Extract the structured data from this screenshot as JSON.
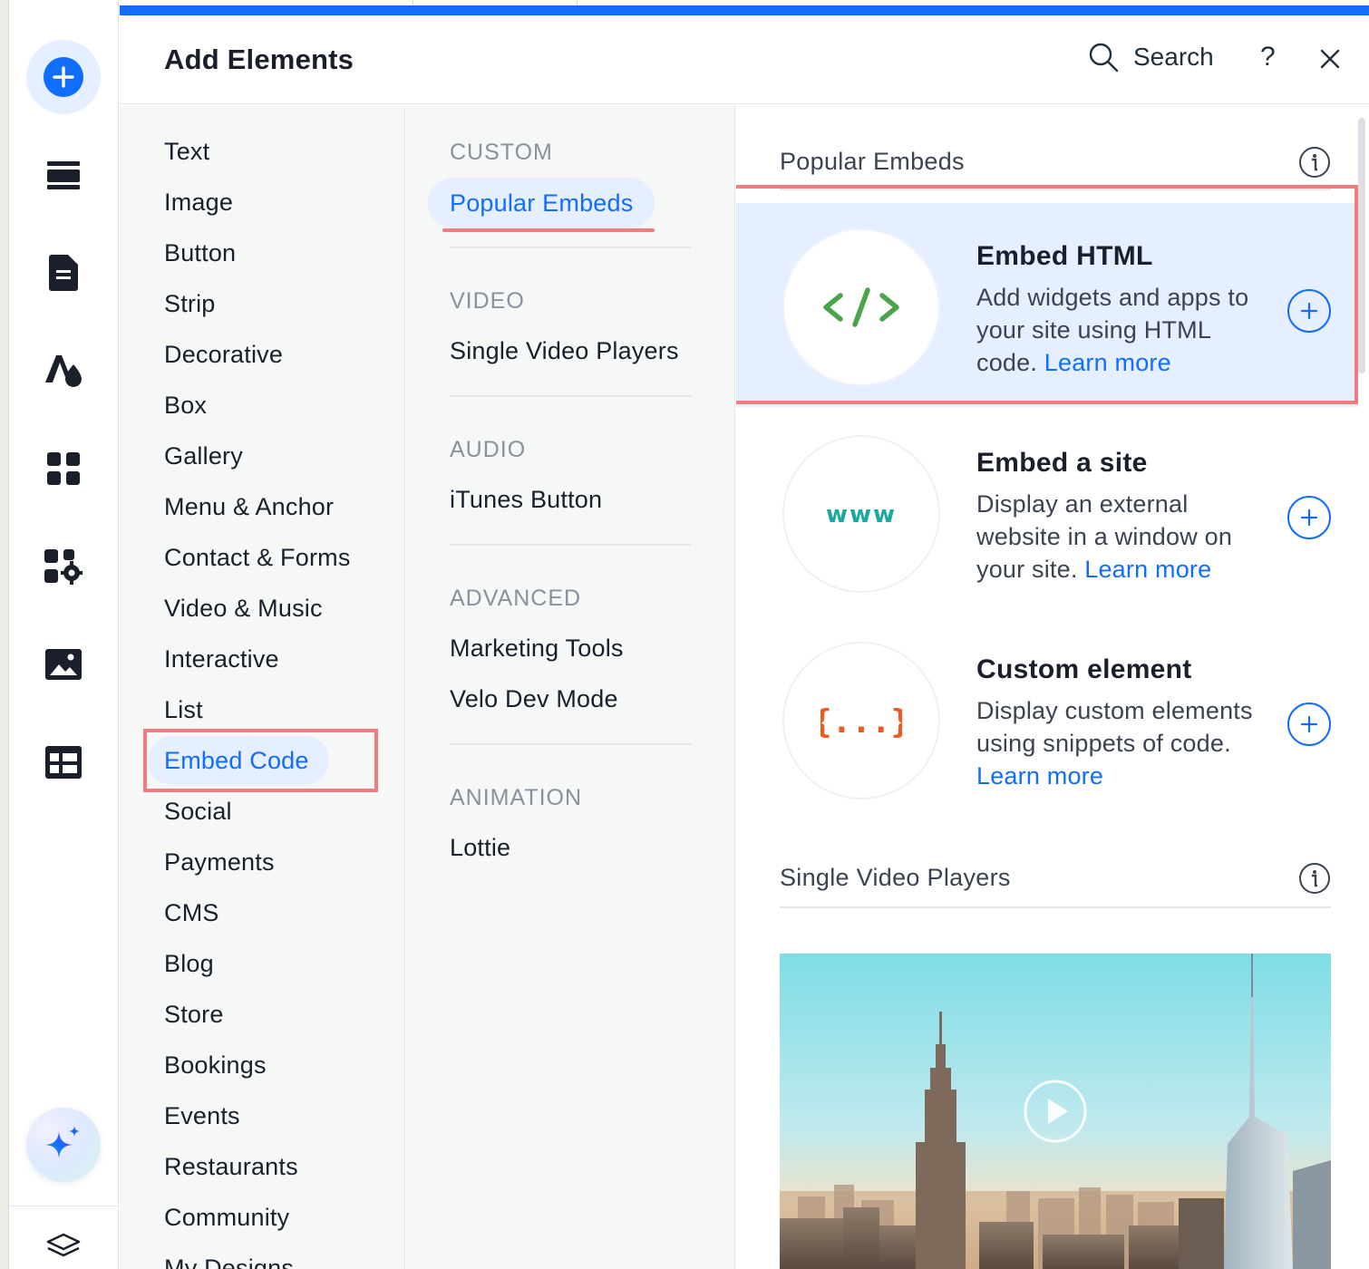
{
  "header": {
    "title": "Add Elements",
    "search_label": "Search",
    "help_label": "?"
  },
  "rail": {
    "icons": [
      "add-icon",
      "sections-icon",
      "pages-icon",
      "theme-icon",
      "apps-icon",
      "business-tools-icon",
      "media-icon",
      "cms-icon",
      "ai-assistant-icon",
      "layers-icon"
    ]
  },
  "categories": {
    "items": [
      "Text",
      "Image",
      "Button",
      "Strip",
      "Decorative",
      "Box",
      "Gallery",
      "Menu & Anchor",
      "Contact & Forms",
      "Video & Music",
      "Interactive",
      "List",
      "Embed Code",
      "Social",
      "Payments",
      "CMS",
      "Blog",
      "Store",
      "Bookings",
      "Events",
      "Restaurants",
      "Community",
      "My Designs"
    ],
    "selected": "Embed Code"
  },
  "subcategories": {
    "custom_header": "CUSTOM",
    "popular_embeds": "Popular Embeds",
    "video_header": "VIDEO",
    "single_video_players": "Single Video Players",
    "audio_header": "AUDIO",
    "itunes_button": "iTunes Button",
    "advanced_header": "ADVANCED",
    "marketing_tools": "Marketing Tools",
    "velo_dev_mode": "Velo Dev Mode",
    "animation_header": "ANIMATION",
    "lottie": "Lottie"
  },
  "content": {
    "popular_embeds_title": "Popular Embeds",
    "cards": [
      {
        "title": "Embed HTML",
        "description": "Add widgets and apps to your site using HTML code.",
        "link": "Learn more",
        "icon_text": "</>",
        "icon_color": "#4aa54a"
      },
      {
        "title": "Embed a site",
        "description": "Display an external website in a window on your site.",
        "link": "Learn more",
        "icon_text": "www",
        "icon_color": "#1aa99e"
      },
      {
        "title": "Custom element",
        "description": "Display custom elements using snippets of code.",
        "link": "Learn more",
        "icon_text": "{...}",
        "icon_color": "#f15a1f"
      }
    ],
    "single_video_players_title": "Single Video Players"
  },
  "colors": {
    "accent": "#116dff",
    "selection_bg": "#e6efff",
    "highlight_box": "#f07d7d"
  }
}
